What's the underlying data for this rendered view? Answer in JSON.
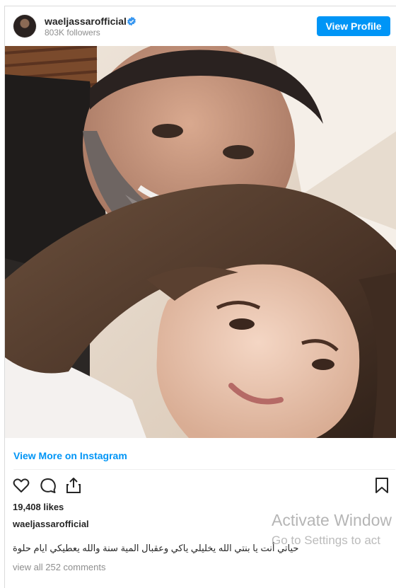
{
  "header": {
    "username": "waeljassarofficial",
    "followers": "803K followers",
    "view_profile_label": "View Profile"
  },
  "view_more_label": "View More on Instagram",
  "post": {
    "likes": "19,408 likes",
    "caption_user": "waeljassarofficial",
    "caption_text": "حياتي أنت يا بنتي الله يخليلي ياكي وعقبال المية سنة والله يعطيكي ايام حلوة",
    "comments_link": "view all 252 comments"
  },
  "watermark": {
    "line1": "Activate Window",
    "line2": "Go to Settings to act"
  },
  "icons": {
    "verified": "verified-badge-icon",
    "like": "heart-icon",
    "comment": "comment-icon",
    "share": "share-icon",
    "save": "bookmark-icon"
  },
  "colors": {
    "accent": "#0095f6",
    "text": "#262626",
    "muted": "#8e8e8e",
    "border": "#dbdbdb"
  }
}
